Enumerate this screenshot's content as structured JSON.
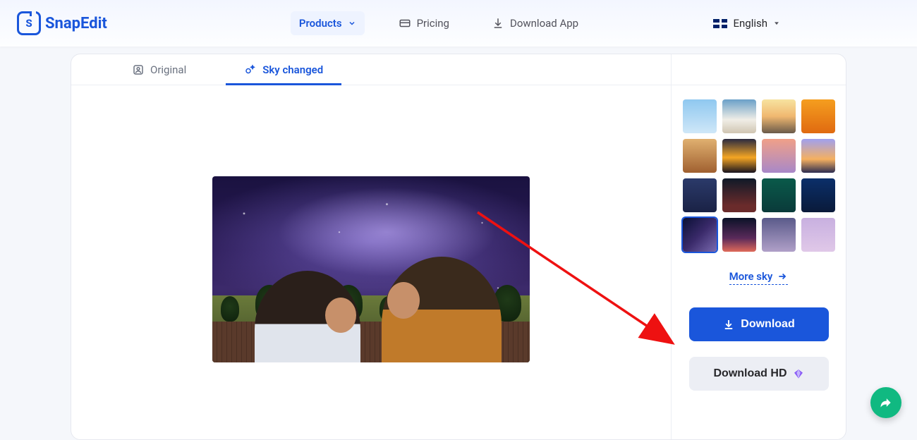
{
  "brand": {
    "name": "SnapEdit",
    "badge_letter": "S"
  },
  "nav": {
    "products": "Products",
    "pricing": "Pricing",
    "download_app": "Download App"
  },
  "language": {
    "label": "English"
  },
  "tabs": {
    "original": "Original",
    "sky_changed": "Sky changed",
    "active": "sky_changed"
  },
  "sidebar": {
    "more_sky": "More sky",
    "download": "Download",
    "download_hd": "Download HD",
    "selected_thumb_index": 12,
    "thumbs": [
      {
        "bg": "linear-gradient(180deg,#8fc8f0 0%,#cfe7f8 100%)"
      },
      {
        "bg": "linear-gradient(180deg,#6aa0c8 0%,#f0eee6 60%,#d0c5b2 100%)"
      },
      {
        "bg": "linear-gradient(180deg,#f7e3a0 0%,#f0b870 50%,#6a5a4a 100%)"
      },
      {
        "bg": "linear-gradient(180deg,#f59e1f 0%,#e06a10 100%)"
      },
      {
        "bg": "linear-gradient(180deg,#e0b070 0%,#a06030 100%)"
      },
      {
        "bg": "linear-gradient(180deg,#2a2a40 0%,#f5a623 55%,#17131f 100%)"
      },
      {
        "bg": "linear-gradient(180deg,#f0a088 0%,#a888c8 100%)"
      },
      {
        "bg": "linear-gradient(180deg,#a0a0f0 0%,#f5b060 60%,#2c2c50 100%)"
      },
      {
        "bg": "linear-gradient(180deg,#2b3a6a 0%,#1a2245 100%)"
      },
      {
        "bg": "linear-gradient(180deg,#0f1928 0%,#6a2b2b 80%)"
      },
      {
        "bg": "linear-gradient(180deg,#0a5a4a 0%,#0a3a3a 100%)"
      },
      {
        "bg": "linear-gradient(180deg,#0b2f6a 0%,#0a1a3a 100%)"
      },
      {
        "bg": "linear-gradient(135deg,#0a1035 0%,#3a2a6a 50%,#7a6ab0 100%)"
      },
      {
        "bg": "linear-gradient(180deg,#0b1228 0%,#5a2a5a 60%,#e06a5a 100%)"
      },
      {
        "bg": "linear-gradient(180deg,#5a5a8a 0%,#b0a0c8 100%)"
      },
      {
        "bg": "linear-gradient(180deg,#c8b0e0 0%,#e0c8e8 100%)"
      }
    ]
  }
}
